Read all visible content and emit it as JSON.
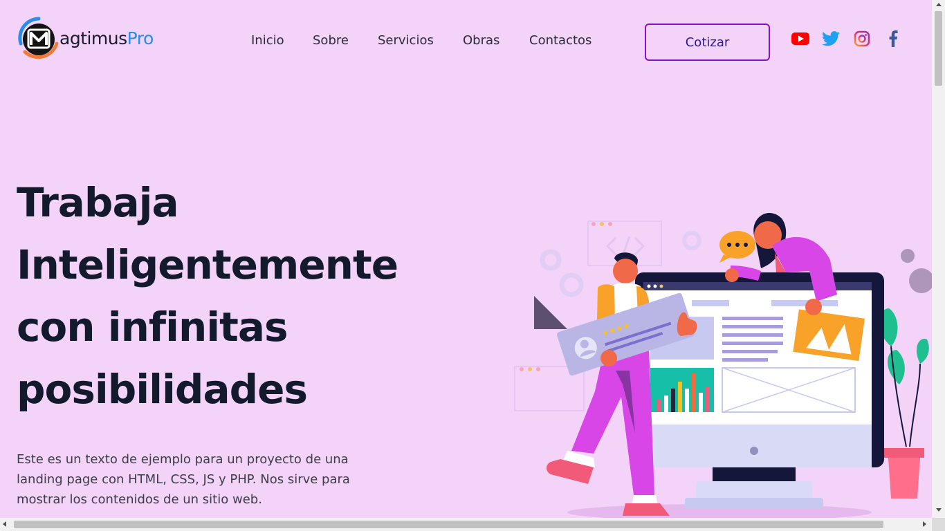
{
  "header": {
    "logo": {
      "mark_letter": "M",
      "text_main": "agtimus",
      "text_accent": "Pro"
    },
    "nav": [
      {
        "label": "Inicio"
      },
      {
        "label": "Sobre"
      },
      {
        "label": "Servicios"
      },
      {
        "label": "Obras"
      },
      {
        "label": "Contactos"
      }
    ],
    "cta_label": "Cotizar",
    "social": [
      {
        "icon": "youtube-icon",
        "color": "#ff0000"
      },
      {
        "icon": "twitter-icon",
        "color": "#1da1f2"
      },
      {
        "icon": "instagram-icon",
        "color": "#c13584"
      },
      {
        "icon": "facebook-icon",
        "color": "#3b5998"
      }
    ]
  },
  "hero": {
    "title_lines": [
      "Trabaja",
      "Inteligentemente",
      "con infinitas",
      "posibilidades"
    ],
    "description_lines": [
      "Este es un texto de ejemplo para un proyecto de una",
      "landing page con HTML, CSS, JS y PHP. Nos sirve para",
      "mostrar los contenidos de un sitio web."
    ]
  },
  "colors": {
    "background": "#f3d3f8",
    "title": "#141a2e",
    "cta_border": "#8a0fd1",
    "cta_text": "#2b1aa0",
    "logo_accent": "#2a8ee8"
  }
}
